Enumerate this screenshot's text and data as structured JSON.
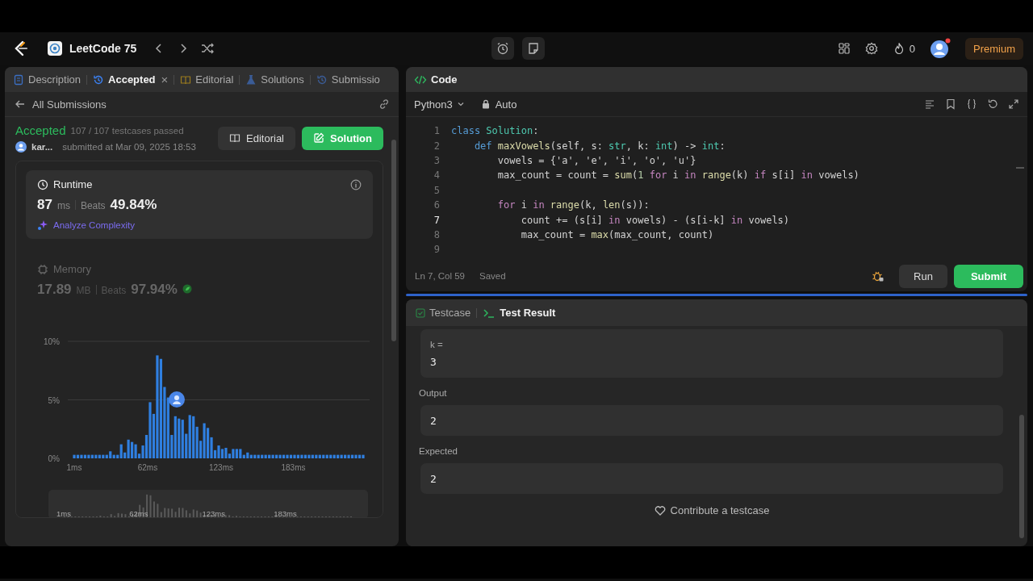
{
  "nav": {
    "title": "LeetCode 75",
    "streak": "0",
    "premium": "Premium"
  },
  "tabs": [
    {
      "label": "Description",
      "selected": false
    },
    {
      "label": "Accepted",
      "selected": true,
      "close_label": "×"
    },
    {
      "label": "Editorial",
      "selected": false
    },
    {
      "label": "Solutions",
      "selected": false
    },
    {
      "label": "Submissio",
      "selected": false
    }
  ],
  "submission": {
    "back_label": "All Submissions",
    "status": "Accepted",
    "passed": "107 / 107 testcases passed",
    "user": "kar...",
    "submitted": "submitted at Mar 09, 2025 18:53",
    "buttons": [
      {
        "label": "Editorial",
        "kind": "secondary"
      },
      {
        "label": "Solution",
        "kind": "primary"
      }
    ]
  },
  "metrics": [
    {
      "title": "Runtime",
      "value": "87",
      "unit": "ms",
      "beats_label": "Beats",
      "beats": "49.84%",
      "link": "Analyze Complexity",
      "selected": true,
      "badge": false
    },
    {
      "title": "Memory",
      "value": "17.89",
      "unit": "MB",
      "beats_label": "Beats",
      "beats": "97.94%",
      "selected": false,
      "badge": true
    }
  ],
  "chart_data": {
    "type": "bar",
    "xlim": [
      1,
      241
    ],
    "ylim": [
      0,
      10
    ],
    "xticks": [
      {
        "value": 1,
        "label": "1ms"
      },
      {
        "value": 62,
        "label": "62ms"
      },
      {
        "value": 123,
        "label": "123ms"
      },
      {
        "value": 183,
        "label": "183ms"
      }
    ],
    "yticks": [
      {
        "value": 0,
        "label": "0%"
      },
      {
        "value": 5,
        "label": "5%"
      },
      {
        "value": 10,
        "label": "10%"
      }
    ],
    "x": [
      1,
      4,
      7,
      10,
      13,
      16,
      19,
      22,
      25,
      28,
      31,
      34,
      37,
      40,
      43,
      46,
      49,
      52,
      55,
      58,
      61,
      64,
      67,
      70,
      73,
      76,
      79,
      82,
      85,
      88,
      91,
      94,
      97,
      100,
      103,
      106,
      109,
      112,
      115,
      118,
      121,
      124,
      127,
      130,
      133,
      136,
      139,
      142,
      145,
      148,
      151,
      154,
      157,
      160,
      163,
      166,
      169,
      172,
      175,
      178,
      181,
      184,
      187,
      190,
      193,
      196,
      199,
      202,
      205,
      208,
      211,
      214,
      217,
      220,
      223,
      226,
      229,
      232,
      235,
      238,
      241
    ],
    "values": [
      0.3,
      0.3,
      0.3,
      0.3,
      0.3,
      0.3,
      0.3,
      0.3,
      0.3,
      0.3,
      0.6,
      0.3,
      0.3,
      1.2,
      0.5,
      1.6,
      1.4,
      1.2,
      0.4,
      1.1,
      2.0,
      4.8,
      3.8,
      8.8,
      8.5,
      6.1,
      5.2,
      2.0,
      3.6,
      3.4,
      3.3,
      2.1,
      3.7,
      3.6,
      2.7,
      1.5,
      3.0,
      2.6,
      1.8,
      0.7,
      1.1,
      0.8,
      0.9,
      0.4,
      0.8,
      0.8,
      0.8,
      0.3,
      0.5,
      0.3,
      0.3,
      0.3,
      0.3,
      0.3,
      0.3,
      0.3,
      0.3,
      0.3,
      0.3,
      0.3,
      0.3,
      0.3,
      0.3,
      0.3,
      0.3,
      0.3,
      0.3,
      0.3,
      0.3,
      0.3,
      0.3,
      0.3,
      0.3,
      0.3,
      0.3,
      0.3,
      0.3,
      0.3,
      0.3,
      0.3,
      0.3
    ]
  },
  "overview_labels": [
    "1ms",
    "62ms",
    "123ms",
    "183ms"
  ],
  "editor": {
    "title": "Code",
    "language": "Python3",
    "mode": "Auto",
    "cursor": "Ln 7, Col 59",
    "save_state": "Saved",
    "lines": [
      {
        "number": "1",
        "current": false,
        "tokens": [
          {
            "text": "class ",
            "kind": "kw"
          },
          {
            "text": "Solution",
            "kind": "cls"
          },
          {
            "text": ":",
            "kind": "p"
          }
        ]
      },
      {
        "number": "2",
        "current": false,
        "tokens": [
          {
            "text": "    def ",
            "kind": "kw"
          },
          {
            "text": "maxVowels",
            "kind": "fn"
          },
          {
            "text": "(self, s: ",
            "kind": "p"
          },
          {
            "text": "str",
            "kind": "ty"
          },
          {
            "text": ", k: ",
            "kind": "p"
          },
          {
            "text": "int",
            "kind": "ty"
          },
          {
            "text": ") -> ",
            "kind": "p"
          },
          {
            "text": "int",
            "kind": "ty"
          },
          {
            "text": ":",
            "kind": "p"
          }
        ]
      },
      {
        "number": "3",
        "current": false,
        "tokens": [
          {
            "text": "        vowels = {'a', 'e', 'i', 'o', 'u'}",
            "kind": "p"
          }
        ]
      },
      {
        "number": "4",
        "current": false,
        "tokens": [
          {
            "text": "        max_count = count = ",
            "kind": "p"
          },
          {
            "text": "sum",
            "kind": "fn"
          },
          {
            "text": "(",
            "kind": "p"
          },
          {
            "text": "1",
            "kind": "num"
          },
          {
            "text": " for",
            "kind": "ctl"
          },
          {
            "text": " i ",
            "kind": "p"
          },
          {
            "text": "in ",
            "kind": "ctl"
          },
          {
            "text": "range",
            "kind": "fn"
          },
          {
            "text": "(k) ",
            "kind": "p"
          },
          {
            "text": "if",
            "kind": "ctl"
          },
          {
            "text": " s[i] ",
            "kind": "p"
          },
          {
            "text": "in",
            "kind": "ctl"
          },
          {
            "text": " vowels)",
            "kind": "p"
          }
        ]
      },
      {
        "number": "5",
        "current": false
      },
      {
        "number": "6",
        "current": false,
        "tokens": [
          {
            "text": "        for",
            "kind": "ctl"
          },
          {
            "text": " i ",
            "kind": "p"
          },
          {
            "text": "in ",
            "kind": "ctl"
          },
          {
            "text": "range",
            "kind": "fn"
          },
          {
            "text": "(k, ",
            "kind": "p"
          },
          {
            "text": "len",
            "kind": "fn"
          },
          {
            "text": "(s)):",
            "kind": "p"
          }
        ]
      },
      {
        "number": "7",
        "current": true,
        "tokens": [
          {
            "text": "            count += (s[i] ",
            "kind": "p"
          },
          {
            "text": "in",
            "kind": "ctl"
          },
          {
            "text": " vowels) - (s[i-k] ",
            "kind": "p"
          },
          {
            "text": "in",
            "kind": "ctl"
          },
          {
            "text": " vowels)",
            "kind": "p"
          }
        ]
      },
      {
        "number": "8",
        "current": false,
        "tokens": [
          {
            "text": "            max_count = ",
            "kind": "p"
          },
          {
            "text": "max",
            "kind": "fn"
          },
          {
            "text": "(max_count, count)",
            "kind": "p"
          }
        ]
      },
      {
        "number": "9",
        "current": false
      }
    ],
    "buttons": [
      {
        "label": "Run",
        "kind": "secondary"
      },
      {
        "label": "Submit",
        "kind": "primary"
      }
    ]
  },
  "result": {
    "tabs": [
      {
        "label": "Testcase",
        "selected": false
      },
      {
        "label": "Test Result",
        "selected": true
      }
    ],
    "fields": [
      {
        "label": "k =",
        "value": "3",
        "kind": "param"
      },
      {
        "label": "Output",
        "value": "2",
        "kind": "output"
      },
      {
        "label": "Expected",
        "value": "2",
        "kind": "output"
      }
    ],
    "contribute": "Contribute a testcase"
  }
}
